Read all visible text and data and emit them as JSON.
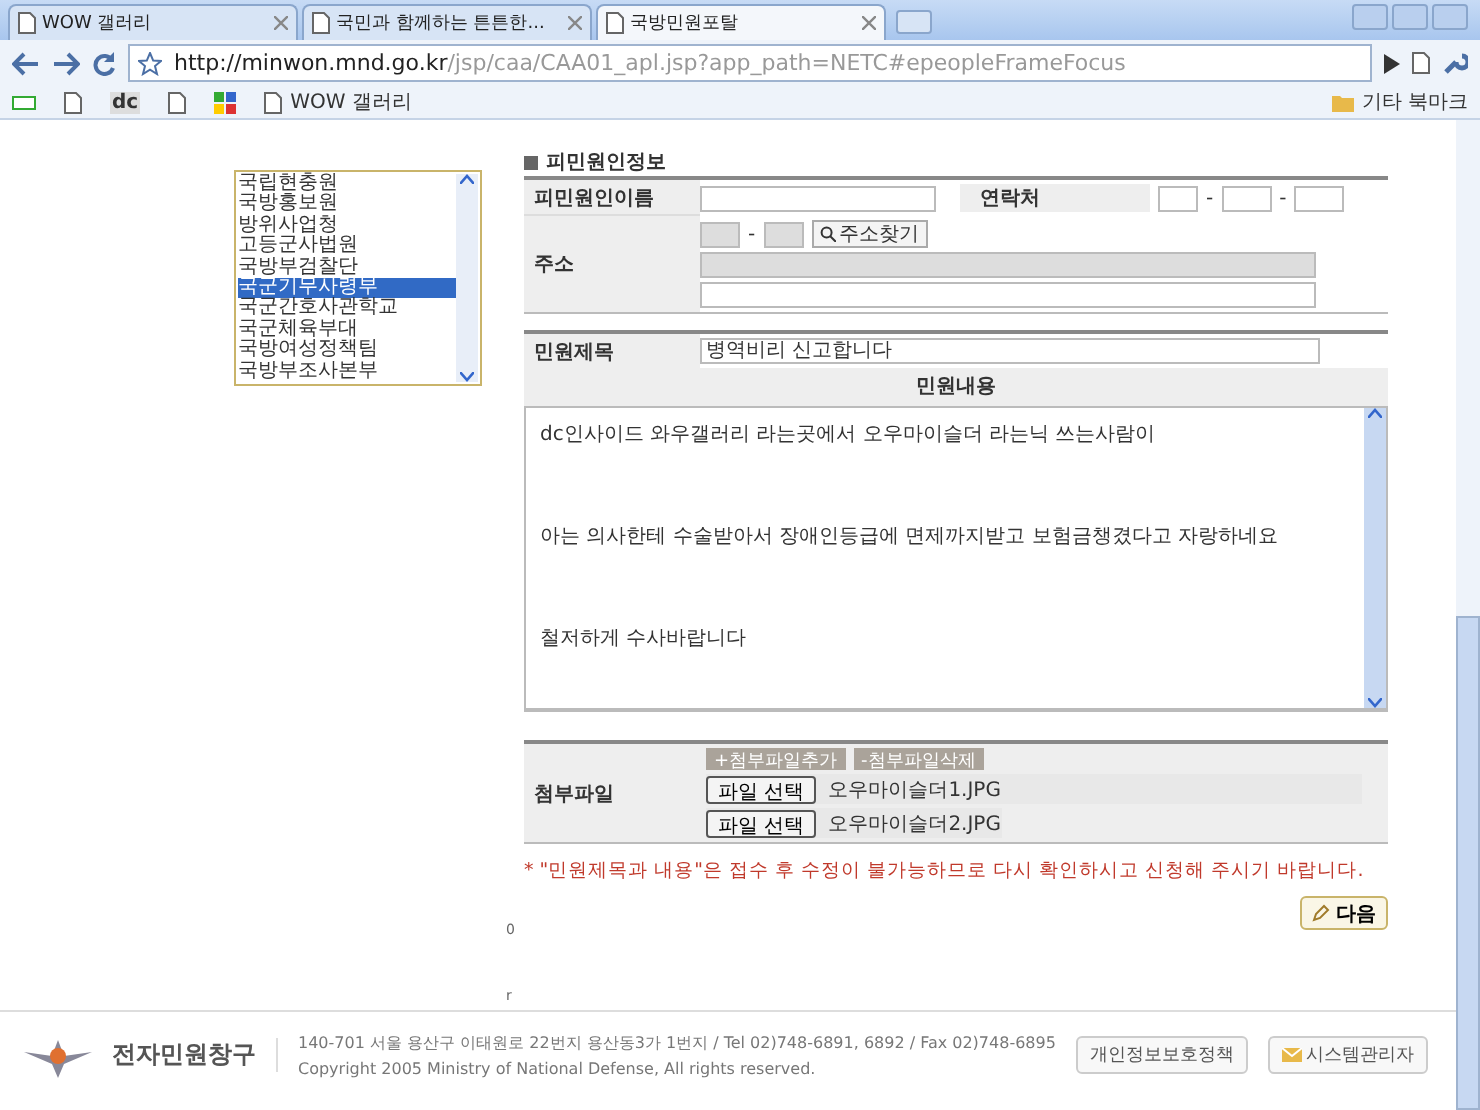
{
  "browser": {
    "tabs": [
      {
        "label": "WOW 갤러리",
        "selected": false
      },
      {
        "label": "국민과 함께하는 튼튼한...",
        "selected": false
      },
      {
        "label": "국방민원포탈",
        "selected": true
      }
    ],
    "address": {
      "host": "http://minwon.mnd.go.kr",
      "path": "/jsp/caa/CAA01_apl.jsp?app_path=NETC#epeopleFrameFocus"
    },
    "bookmarks": [
      {
        "kind": "green"
      },
      {
        "kind": "page"
      },
      {
        "kind": "dc",
        "label": "dc"
      },
      {
        "kind": "page"
      },
      {
        "kind": "google"
      },
      {
        "kind": "page",
        "label": "WOW 갤러리"
      }
    ],
    "other_bookmarks": "기타 북마크"
  },
  "org_list": [
    {
      "label": "국립현충원",
      "selected": false
    },
    {
      "label": "국방홍보원",
      "selected": false
    },
    {
      "label": "방위사업청",
      "selected": false
    },
    {
      "label": "고등군사법원",
      "selected": false
    },
    {
      "label": "국방부검찰단",
      "selected": false
    },
    {
      "label": "국군기무사령부",
      "selected": true
    },
    {
      "label": "국군간호사관학교",
      "selected": false
    },
    {
      "label": "국군체육부대",
      "selected": false
    },
    {
      "label": "국방여성정책팀",
      "selected": false
    },
    {
      "label": "국방부조사본부",
      "selected": false
    }
  ],
  "petitioner": {
    "title": "피민원인정보",
    "name_label": "피민원인이름",
    "contact_label": "연락처",
    "phone_dash": "-",
    "address_label": "주소",
    "zip_dash": "-",
    "find_address": "주소찾기"
  },
  "petition": {
    "subject_label": "민원제목",
    "subject": "병역비리 신고합니다",
    "content_label": "민원내용",
    "content": [
      "dc인사이드 와우갤러리 라는곳에서 오우마이슬더 라는닉 쓰는사람이",
      "아는 의사한테 수술받아서 장애인등급에 면제까지받고 보험금챙겼다고 자랑하네요",
      "철저하게 수사바랍니다"
    ]
  },
  "attachments": {
    "label": "첨부파일",
    "add": "+첨부파일추가",
    "remove": "-첨부파일삭제",
    "files": [
      {
        "button": "파일 선택",
        "name": "오우마이슬더1.JPG"
      },
      {
        "button": "파일 선택",
        "name": "오우마이슬더2.JPG"
      }
    ]
  },
  "notice": "* \"민원제목과 내용\"은 접수 후 수정이 불가능하므로 다시 확인하시고 신청해 주시기 바랍니다.",
  "next_button": "다음",
  "stray_marks": [
    "0",
    "r"
  ],
  "footer": {
    "logo": "전자민원창구",
    "address": "140-701 서울 용산구 이태원로 22번지 용산동3가 1번지 / Tel 02)748-6891, 6892 / Fax 02)748-6895",
    "copyright": "Copyright 2005 Ministry of National Defense, All rights reserved.",
    "privacy": "개인정보보호정책",
    "admin": "시스템관리자"
  }
}
